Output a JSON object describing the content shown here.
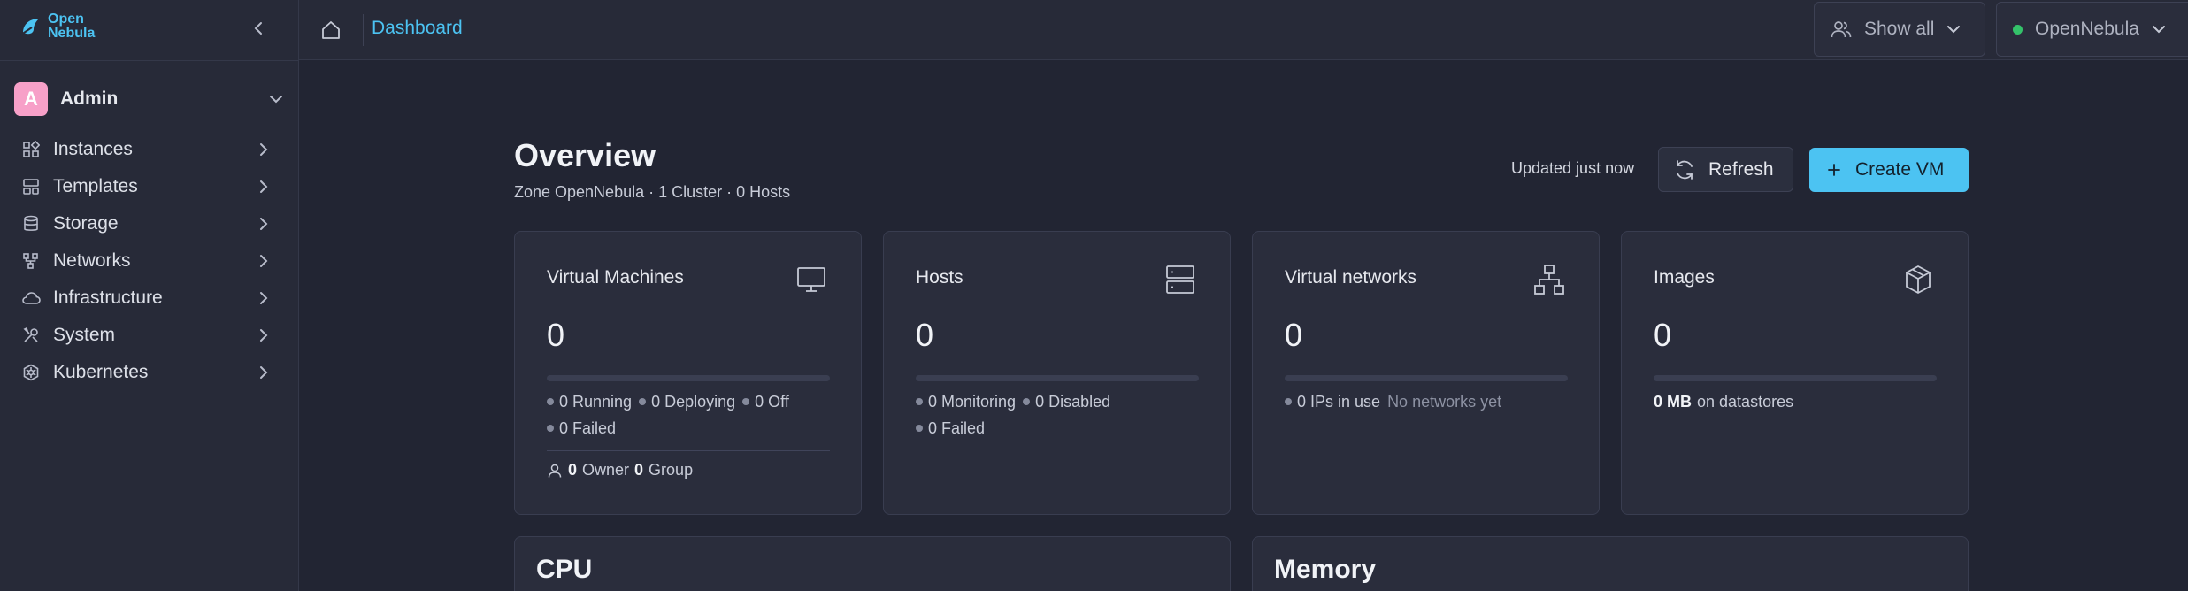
{
  "app": {
    "logo_line1": "Open",
    "logo_line2": "Nebula"
  },
  "user": {
    "initial": "A",
    "name": "Admin"
  },
  "sidebar": {
    "items": [
      {
        "label": "Instances",
        "icon": "grid-icon"
      },
      {
        "label": "Templates",
        "icon": "template-icon"
      },
      {
        "label": "Storage",
        "icon": "database-icon"
      },
      {
        "label": "Networks",
        "icon": "network-icon"
      },
      {
        "label": "Infrastructure",
        "icon": "cloud-icon"
      },
      {
        "label": "System",
        "icon": "tools-icon"
      },
      {
        "label": "Kubernetes",
        "icon": "kubernetes-icon"
      }
    ]
  },
  "topbar": {
    "breadcrumb": "Dashboard",
    "show_all_label": "Show all",
    "zone_label": "OpenNebula",
    "zone_status_color": "#34c26a"
  },
  "overview": {
    "title": "Overview",
    "subtitle": "Zone OpenNebula · 1 Cluster · 0 Hosts",
    "updated": "Updated just now",
    "refresh_label": "Refresh",
    "create_label": "Create VM",
    "accent_color": "#4cc3f2"
  },
  "cards": {
    "vms": {
      "title": "Virtual Machines",
      "count": "0",
      "running": "0 Running",
      "deploying": "0 Deploying",
      "off": "0 Off",
      "failed": "0 Failed",
      "owner_count": "0",
      "owner_label": "Owner",
      "group_count": "0",
      "group_label": "Group"
    },
    "hosts": {
      "title": "Hosts",
      "count": "0",
      "monitoring": "0 Monitoring",
      "disabled": "0 Disabled",
      "failed": "0 Failed"
    },
    "vnets": {
      "title": "Virtual networks",
      "count": "0",
      "ips_in_use": "0 IPs in use",
      "no_networks": "No networks yet"
    },
    "images": {
      "title": "Images",
      "count": "0",
      "size": "0 MB",
      "size_suffix": "on datastores"
    }
  },
  "panels": {
    "cpu_title": "CPU",
    "memory_title": "Memory"
  }
}
